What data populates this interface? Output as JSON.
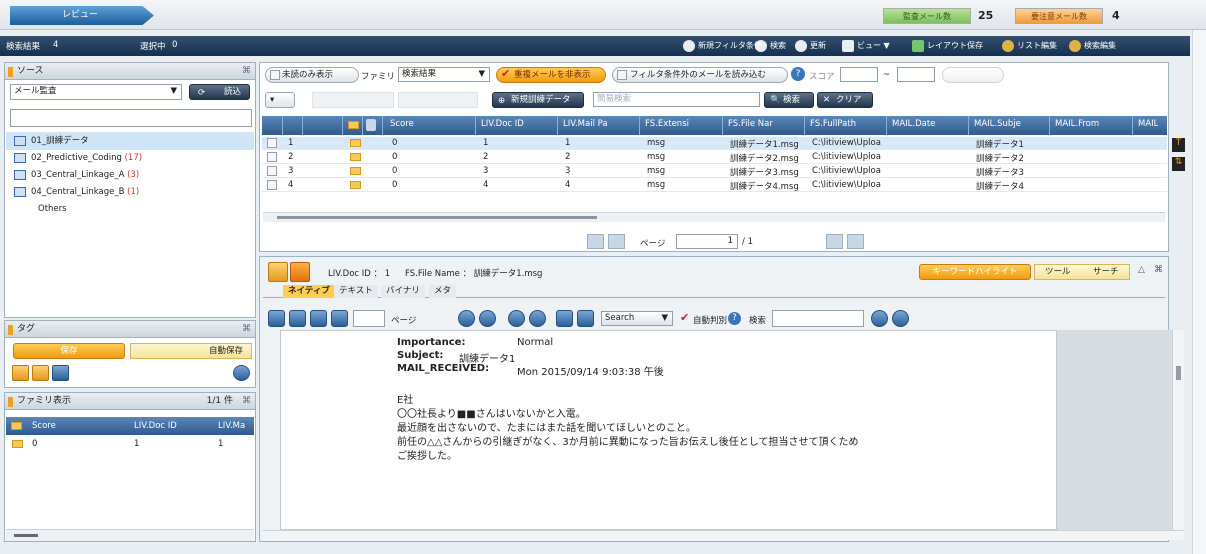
{
  "topbar": {
    "review_tab": "レビュー",
    "audit_mail_label": "監査メール数",
    "audit_mail_count": "25",
    "caution_mail_label": "要注意メール数",
    "caution_mail_count": "4"
  },
  "toolbar": {
    "search_result_label": "検索結果",
    "search_result_count": "4",
    "selected_label": "選択中",
    "selected_count": "0",
    "buttons": [
      "新規フィルタ条件",
      "検索",
      "更新",
      "ビュー ▼",
      "レイアウト保存",
      "リスト編集",
      "検索編集"
    ]
  },
  "source_panel": {
    "title": "ソース",
    "source_select": "メール監査",
    "load_button": "読込",
    "items": [
      {
        "label": "01_訓練データ",
        "count": ""
      },
      {
        "label": "02_Predictive_Coding",
        "count": "(17)"
      },
      {
        "label": "03_Central_Linkage_A",
        "count": "(3)"
      },
      {
        "label": "04_Central_Linkage_B",
        "count": "(1)"
      }
    ],
    "others": "Others"
  },
  "tag_panel": {
    "title": "タグ",
    "save_button": "保存",
    "autosave_label": "自動保存"
  },
  "family_panel": {
    "title": "ファミリ表示",
    "page": "1/1 件",
    "columns": [
      "Score",
      "LIV.Doc ID",
      "LIV.Ma"
    ],
    "row": {
      "score": "0",
      "doc_id": "1",
      "mail": "1"
    }
  },
  "filterbar": {
    "unread_only": "未読のみ表示",
    "family_label": "ファミリ",
    "family_select": "検索結果",
    "hide_dup": "重複メールを非表示",
    "load_filter": "フィルタ条件外のメールを読み込む",
    "score_label": "スコア",
    "score_sep": "~"
  },
  "row2": {
    "new_training_data": "新規訓練データ",
    "quick_search_placeholder": "簡易検索",
    "search_button": "検索",
    "clear_button": "クリア"
  },
  "grid": {
    "columns": [
      "Score",
      "LIV.Doc ID",
      "LIV.Mail Pa",
      "FS.Extensi",
      "FS.File Nar",
      "FS.FullPath",
      "MAIL.Date",
      "MAIL.Subje",
      "MAIL.From",
      "MAIL"
    ],
    "rows": [
      {
        "n": "1",
        "score": "0",
        "doc": "1",
        "mail": "1",
        "ext": "msg",
        "file": "訓練データ1.msg",
        "path": "C:\\litiview\\Uploa",
        "subj": "訓練データ1"
      },
      {
        "n": "2",
        "score": "0",
        "doc": "2",
        "mail": "2",
        "ext": "msg",
        "file": "訓練データ2.msg",
        "path": "C:\\litiview\\Uploa",
        "subj": "訓練データ2"
      },
      {
        "n": "3",
        "score": "0",
        "doc": "3",
        "mail": "3",
        "ext": "msg",
        "file": "訓練データ3.msg",
        "path": "C:\\litiview\\Uploa",
        "subj": "訓練データ3"
      },
      {
        "n": "4",
        "score": "0",
        "doc": "4",
        "mail": "4",
        "ext": "msg",
        "file": "訓練データ4.msg",
        "path": "C:\\litiview\\Uploa",
        "subj": "訓練データ4"
      }
    ]
  },
  "pager": {
    "page_label": "ページ",
    "current": "1",
    "total": "/ 1"
  },
  "viewer": {
    "doc_id_label": "LIV.Doc ID ： 1",
    "file_name_label": "FS.File Name ： 訓練データ1.msg",
    "highlight_button": "キーワードハイライト",
    "tools_label": "ツール",
    "search_label": "サーチ",
    "tabs": [
      "ネイティブ",
      "テキスト",
      "バイナリ",
      "メタ"
    ],
    "page_label": "ページ",
    "search_select": "Search",
    "auto_detect": "自動判別",
    "search_text_label": "検索",
    "importance_label": "Importance:",
    "importance": "Normal",
    "subject_label": "Subject:",
    "subject": "訓練データ1",
    "received_label": "MAIL_RECEIVED:",
    "received": "Mon 2015/09/14 9:03:38 午後",
    "body": [
      "E社",
      "〇〇社長より■■さんはいないかと入電。",
      "最近顔を出さないので、たまにはまた話を聞いてほしいとのこと。",
      "前任の△△さんからの引継ぎがなく、3か月前に異動になった旨お伝えし後任として担当させて頂くため",
      "ご挨拶した。"
    ]
  }
}
